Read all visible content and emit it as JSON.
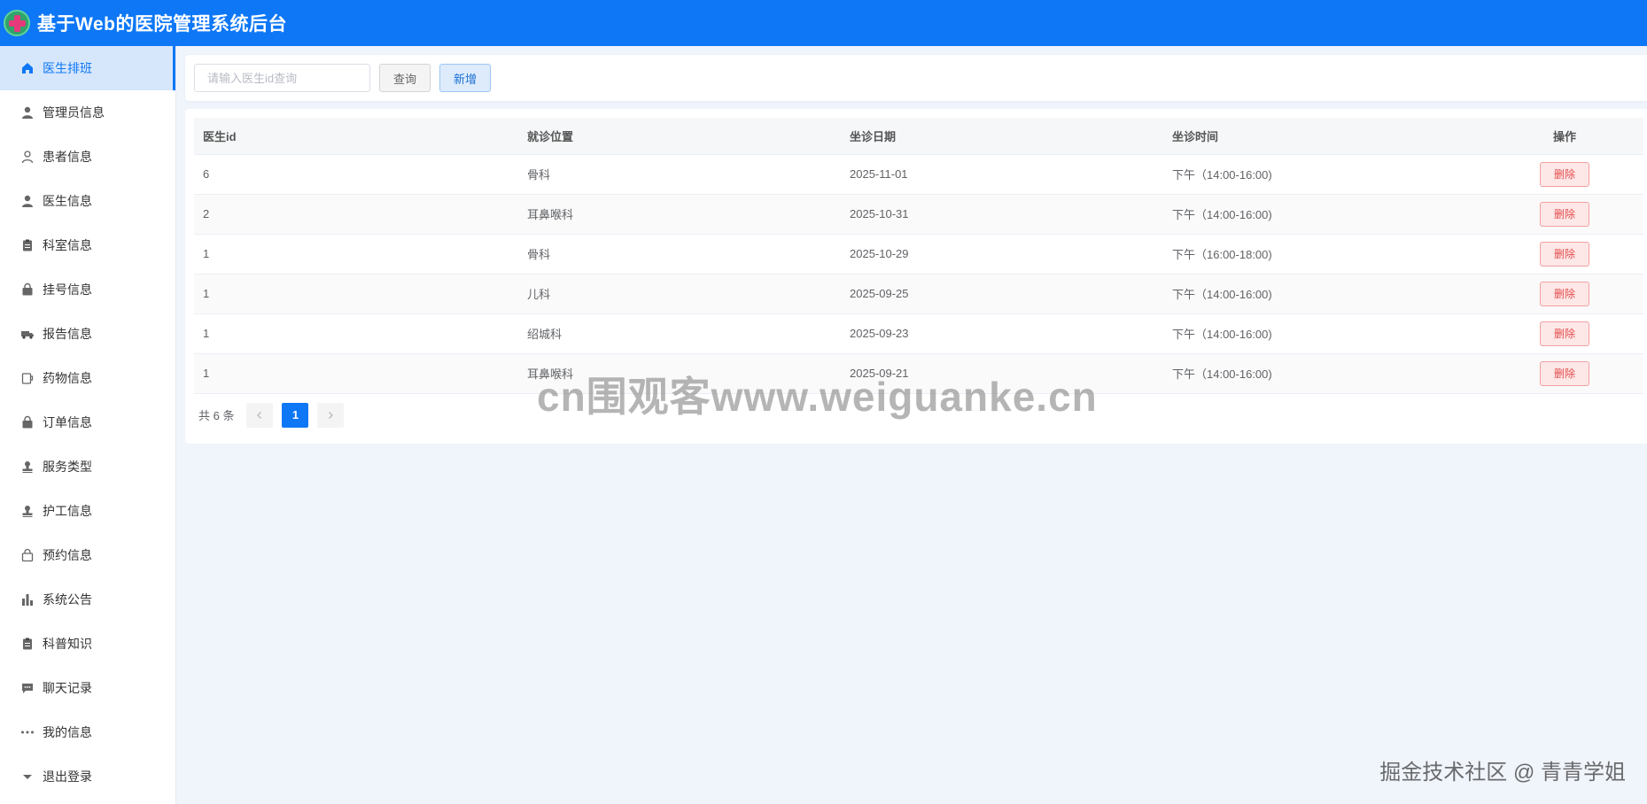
{
  "header": {
    "title": "基于Web的医院管理系统后台",
    "logo_icon": "hospital-cross-logo"
  },
  "sidebar": {
    "items": [
      {
        "label": "医生排班",
        "icon": "home-icon",
        "active": true
      },
      {
        "label": "管理员信息",
        "icon": "user-icon"
      },
      {
        "label": "患者信息",
        "icon": "user-outline-icon"
      },
      {
        "label": "医生信息",
        "icon": "user-icon"
      },
      {
        "label": "科室信息",
        "icon": "clipboard-icon"
      },
      {
        "label": "挂号信息",
        "icon": "lock-bag-icon"
      },
      {
        "label": "报告信息",
        "icon": "truck-icon"
      },
      {
        "label": "药物信息",
        "icon": "cup-icon"
      },
      {
        "label": "订单信息",
        "icon": "lock-bag-icon"
      },
      {
        "label": "服务类型",
        "icon": "stamp-icon"
      },
      {
        "label": "护工信息",
        "icon": "stamp-icon"
      },
      {
        "label": "预约信息",
        "icon": "bag-outline-icon"
      },
      {
        "label": "系统公告",
        "icon": "bar-chart-icon"
      },
      {
        "label": "科普知识",
        "icon": "clipboard-icon"
      },
      {
        "label": "聊天记录",
        "icon": "chat-icon"
      },
      {
        "label": "我的信息",
        "icon": "more-icon"
      },
      {
        "label": "退出登录",
        "icon": "caret-down-icon"
      }
    ]
  },
  "toolbar": {
    "search_placeholder": "请输入医生id查询",
    "query_label": "查询",
    "add_label": "新增"
  },
  "table": {
    "columns": [
      "医生id",
      "就诊位置",
      "坐诊日期",
      "坐诊时间",
      "操作"
    ],
    "rows": [
      {
        "doctor_id": "6",
        "location": "骨科",
        "date": "2025-11-01",
        "time": "下午（14:00-16:00)",
        "action": "删除"
      },
      {
        "doctor_id": "2",
        "location": "耳鼻喉科",
        "date": "2025-10-31",
        "time": "下午（14:00-16:00)",
        "action": "删除"
      },
      {
        "doctor_id": "1",
        "location": "骨科",
        "date": "2025-10-29",
        "time": "下午（16:00-18:00)",
        "action": "删除"
      },
      {
        "doctor_id": "1",
        "location": "儿科",
        "date": "2025-09-25",
        "time": "下午（14:00-16:00)",
        "action": "删除"
      },
      {
        "doctor_id": "1",
        "location": "绍城科",
        "date": "2025-09-23",
        "time": "下午（14:00-16:00)",
        "action": "删除"
      },
      {
        "doctor_id": "1",
        "location": "耳鼻喉科",
        "date": "2025-09-21",
        "time": "下午（14:00-16:00)",
        "action": "删除"
      }
    ]
  },
  "pagination": {
    "total_text": "共 6 条",
    "current_page": "1"
  },
  "watermark": "cn围观客www.weiguanke.cn",
  "footer_credit": "掘金技术社区 @ 青青学姐",
  "colors": {
    "primary": "#0d77f6",
    "danger": "#e44d4d",
    "background": "#f0f4fb"
  }
}
